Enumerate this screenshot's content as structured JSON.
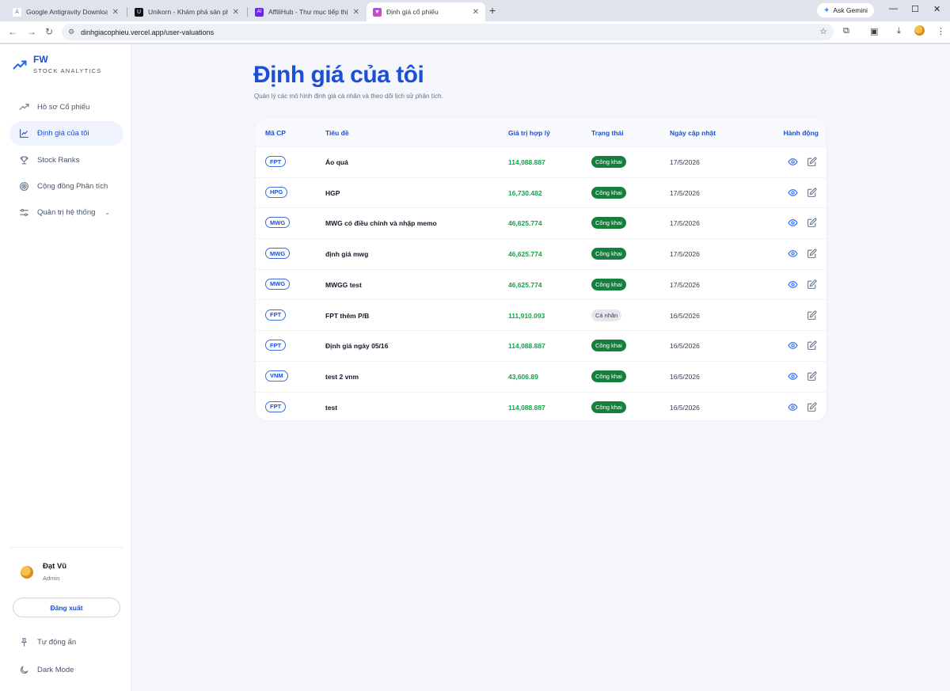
{
  "browser": {
    "tabs": [
      {
        "label": "Google Antigravity Download",
        "active": false
      },
      {
        "label": "Unikorn - Khám phá sản phẩm",
        "active": false
      },
      {
        "label": "AffiliHub - Thư mục tiếp thị liê",
        "active": false
      },
      {
        "label": "Định giá cổ phiếu",
        "active": true
      }
    ],
    "ask_gemini": "Ask Gemini",
    "url": "dinhgiacophieu.vercel.app/user-valuations"
  },
  "brand": {
    "name": "FW",
    "subtitle": "STOCK ANALYTICS",
    "color": "#1d4ed8"
  },
  "sidebar": {
    "items": [
      {
        "label": "Hồ sơ Cổ phiếu",
        "icon": "trending-up-icon",
        "active": false
      },
      {
        "label": "Định giá của tôi",
        "icon": "line-chart-icon",
        "active": true
      },
      {
        "label": "Stock Ranks",
        "icon": "trophy-icon",
        "active": false
      },
      {
        "label": "Cộng đồng Phân tích",
        "icon": "target-icon",
        "active": false
      },
      {
        "label": "Quản trị hệ thống",
        "icon": "sliders-icon",
        "active": false
      }
    ],
    "user": {
      "name": "Đạt Vũ",
      "role": "Admin"
    },
    "logout": "Đăng xuất",
    "auto_hide": "Tự động ẩn",
    "dark_mode": "Dark Mode"
  },
  "main": {
    "title": "Định giá của tôi",
    "subtitle": "Quản lý các mô hình định giá cá nhân và theo dõi lịch sử phân tích.",
    "columns": [
      "Mã CP",
      "Tiêu đề",
      "Giá trị hợp lý",
      "Trạng thái",
      "Ngày cập nhật",
      "Hành động"
    ],
    "rows": [
      {
        "ticker": "FPT",
        "title": "Áo quá",
        "fair_value": "114,088.887",
        "status": "Công khai",
        "public": true,
        "date": "17/5/2026"
      },
      {
        "ticker": "HPG",
        "title": "HGP",
        "fair_value": "16,730.482",
        "status": "Công khai",
        "public": true,
        "date": "17/5/2026"
      },
      {
        "ticker": "MWG",
        "title": "MWG có điều chỉnh và nhập memo",
        "fair_value": "46,625.774",
        "status": "Công khai",
        "public": true,
        "date": "17/5/2026"
      },
      {
        "ticker": "MWG",
        "title": "định giá mwg",
        "fair_value": "46,625.774",
        "status": "Công khai",
        "public": true,
        "date": "17/5/2026"
      },
      {
        "ticker": "MWG",
        "title": "MWGG test",
        "fair_value": "46,625.774",
        "status": "Công khai",
        "public": true,
        "date": "17/5/2026"
      },
      {
        "ticker": "FPT",
        "title": "FPT thêm P/B",
        "fair_value": "111,910.093",
        "status": "Cá nhân",
        "public": false,
        "date": "16/5/2026"
      },
      {
        "ticker": "FPT",
        "title": "Định giá ngày 05/16",
        "fair_value": "114,088.887",
        "status": "Công khai",
        "public": true,
        "date": "16/5/2026"
      },
      {
        "ticker": "VNM",
        "title": "test 2 vnm",
        "fair_value": "43,606.89",
        "status": "Công khai",
        "public": true,
        "date": "16/5/2026"
      },
      {
        "ticker": "FPT",
        "title": "test",
        "fair_value": "114,088.887",
        "status": "Công khai",
        "public": true,
        "date": "16/5/2026"
      }
    ]
  },
  "colors": {
    "accent": "#1d4ed8",
    "positive": "#16a34a",
    "status_public": "#15803d",
    "status_private": "#e5e7eb"
  }
}
